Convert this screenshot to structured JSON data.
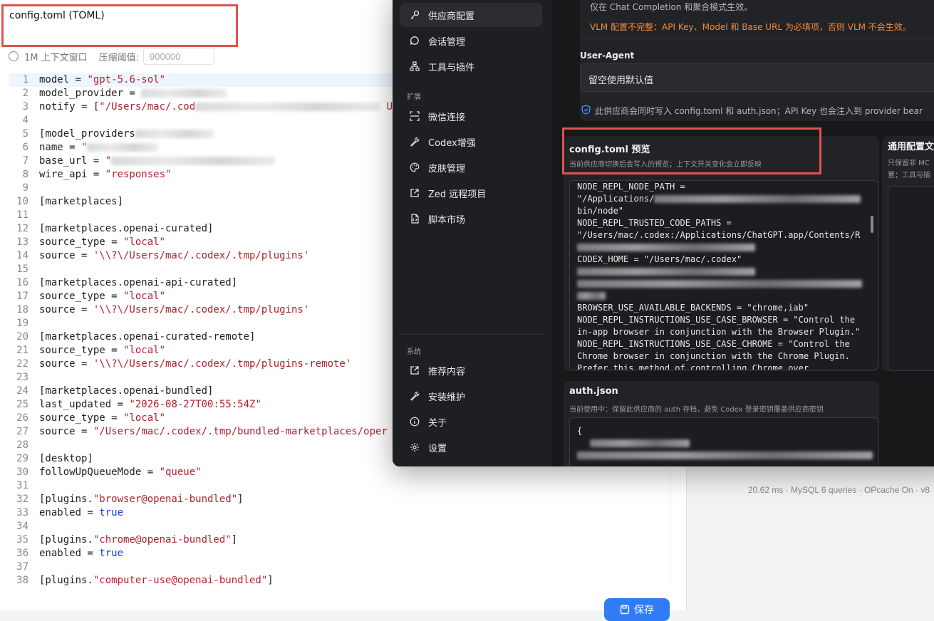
{
  "editor": {
    "title": "config.toml (TOML)",
    "context_label": "1M 上下文窗口",
    "threshold_label": "压缩阈值:",
    "threshold_placeholder": "900000",
    "save_label": "保存",
    "lines": [
      {
        "n": "1",
        "t": [
          [
            "model = ",
            ""
          ],
          [
            "\"gpt-5.6-sol\"",
            "s"
          ]
        ]
      },
      {
        "n": "2",
        "t": [
          [
            "model_provider = ",
            ""
          ]
        ],
        "blur": 120
      },
      {
        "n": "3",
        "t": [
          [
            "notify = [",
            ""
          ],
          [
            "\"/Users/mac/.cod",
            "s"
          ]
        ],
        "blur": 260,
        "tail": [
          [
            "U",
            "s"
          ]
        ]
      },
      {
        "n": "4",
        "t": []
      },
      {
        "n": "5",
        "t": [
          [
            "[model_providers",
            ""
          ]
        ],
        "blur": 110
      },
      {
        "n": "6",
        "t": [
          [
            "name = ",
            ""
          ],
          [
            "\"",
            "s"
          ]
        ],
        "blur": 100
      },
      {
        "n": "7",
        "t": [
          [
            "base_url = ",
            ""
          ],
          [
            "\"",
            "s"
          ]
        ],
        "blur": 230
      },
      {
        "n": "8",
        "t": [
          [
            "wire_api = ",
            ""
          ],
          [
            "\"responses\"",
            "s"
          ]
        ]
      },
      {
        "n": "9",
        "t": []
      },
      {
        "n": "10",
        "t": [
          [
            "[marketplaces]",
            ""
          ]
        ]
      },
      {
        "n": "11",
        "t": []
      },
      {
        "n": "12",
        "t": [
          [
            "[marketplaces.openai-curated]",
            ""
          ]
        ]
      },
      {
        "n": "13",
        "t": [
          [
            "source_type = ",
            ""
          ],
          [
            "\"local\"",
            "s"
          ]
        ]
      },
      {
        "n": "14",
        "t": [
          [
            "source = ",
            ""
          ],
          [
            "'\\\\?\\/Users/mac/.codex/.tmp/plugins'",
            "s"
          ]
        ]
      },
      {
        "n": "15",
        "t": []
      },
      {
        "n": "16",
        "t": [
          [
            "[marketplaces.openai-api-curated]",
            ""
          ]
        ]
      },
      {
        "n": "17",
        "t": [
          [
            "source_type = ",
            ""
          ],
          [
            "\"local\"",
            "s"
          ]
        ]
      },
      {
        "n": "18",
        "t": [
          [
            "source = ",
            ""
          ],
          [
            "'\\\\?\\/Users/mac/.codex/.tmp/plugins'",
            "s"
          ]
        ]
      },
      {
        "n": "19",
        "t": []
      },
      {
        "n": "20",
        "t": [
          [
            "[marketplaces.openai-curated-remote]",
            ""
          ]
        ]
      },
      {
        "n": "21",
        "t": [
          [
            "source_type = ",
            ""
          ],
          [
            "\"local\"",
            "s"
          ]
        ]
      },
      {
        "n": "22",
        "t": [
          [
            "source = ",
            ""
          ],
          [
            "'\\\\?\\/Users/mac/.codex/.tmp/plugins-remote'",
            "s"
          ]
        ]
      },
      {
        "n": "23",
        "t": []
      },
      {
        "n": "24",
        "t": [
          [
            "[marketplaces.openai-bundled]",
            ""
          ]
        ]
      },
      {
        "n": "25",
        "t": [
          [
            "last_updated = ",
            ""
          ],
          [
            "\"2026-08-27T00:55:54Z\"",
            "s"
          ]
        ]
      },
      {
        "n": "26",
        "t": [
          [
            "source_type = ",
            ""
          ],
          [
            "\"local\"",
            "s"
          ]
        ]
      },
      {
        "n": "27",
        "t": [
          [
            "source = ",
            ""
          ],
          [
            "\"/Users/mac/.codex/.tmp/bundled-marketplaces/oper",
            "s"
          ]
        ]
      },
      {
        "n": "28",
        "t": []
      },
      {
        "n": "29",
        "t": [
          [
            "[desktop]",
            ""
          ]
        ]
      },
      {
        "n": "30",
        "t": [
          [
            "followUpQueueMode = ",
            ""
          ],
          [
            "\"queue\"",
            "s"
          ]
        ]
      },
      {
        "n": "31",
        "t": []
      },
      {
        "n": "32",
        "t": [
          [
            "[plugins.",
            ""
          ],
          [
            "\"browser@openai-bundled\"",
            "s"
          ],
          [
            "]",
            ""
          ]
        ]
      },
      {
        "n": "33",
        "t": [
          [
            "enabled = ",
            ""
          ],
          [
            "true",
            "k"
          ]
        ]
      },
      {
        "n": "34",
        "t": []
      },
      {
        "n": "35",
        "t": [
          [
            "[plugins.",
            ""
          ],
          [
            "\"chrome@openai-bundled\"",
            "s"
          ],
          [
            "]",
            ""
          ]
        ]
      },
      {
        "n": "36",
        "t": [
          [
            "enabled = ",
            ""
          ],
          [
            "true",
            "k"
          ]
        ]
      },
      {
        "n": "37",
        "t": []
      },
      {
        "n": "38",
        "t": [
          [
            "[plugins.",
            ""
          ],
          [
            "\"computer-use@openai-bundled\"",
            "s"
          ],
          [
            "]",
            ""
          ]
        ]
      }
    ]
  },
  "footer_stats": "20.62 ms · MySQL 6 queries · OPcache On · v8",
  "app": {
    "sidebar": {
      "items_top": [
        {
          "label": "供应商配置",
          "icon": "key-icon",
          "active": true
        },
        {
          "label": "会话管理",
          "icon": "chat-icon"
        },
        {
          "label": "工具与插件",
          "icon": "nodes-icon"
        }
      ],
      "section_ext": "扩展",
      "items_ext": [
        {
          "label": "微信连接",
          "icon": "scan-icon"
        },
        {
          "label": "Codex增强",
          "icon": "wrench-icon"
        },
        {
          "label": "皮肤管理",
          "icon": "palette-icon"
        },
        {
          "label": "Zed 远程项目",
          "icon": "external-link-icon"
        },
        {
          "label": "脚本市场",
          "icon": "file-code-icon"
        }
      ],
      "section_sys": "系统",
      "items_sys": [
        {
          "label": "推荐内容",
          "icon": "external-link-icon"
        },
        {
          "label": "安装维护",
          "icon": "wrench-icon"
        },
        {
          "label": "关于",
          "icon": "info-icon"
        },
        {
          "label": "设置",
          "icon": "gear-icon"
        }
      ]
    },
    "main": {
      "chat_note": "仅在 Chat Completion 和聚合模式生效。",
      "vlm_warning": "VLM 配置不完整：API Key、Model 和 Base URL 为必填项，否则 VLM 不会生效。",
      "ua_label": "User-Agent",
      "ua_value": "留空使用默认值",
      "write_note": "此供应商会同时写入 config.toml 和 auth.json；API Key 也会注入到 provider bear",
      "preview_title": "config.toml 预览",
      "preview_desc": "当前供应商切换后会写入的预览；上下文开关变化会立即反映",
      "preview_lines": [
        "NODE_REPL_NODE_PATH =",
        "\"/Applications/",
        "bin/node\"",
        "NODE_REPL_TRUSTED_CODE_PATHS =",
        "\"/Users/mac/.codex:/Applications/ChatGPT.app/Contents/R",
        "",
        "CODEX_HOME = \"/Users/mac/.codex\"",
        "",
        "",
        "",
        "BROWSER_USE_AVAILABLE_BACKENDS = \"chrome,iab\"",
        "NODE_REPL_INSTRUCTIONS_USE_CASE_BROWSER = \"Control the",
        "in-app browser in conjunction with the Browser Plugin.\"",
        "NODE_REPL_INSTRUCTIONS_USE_CASE_CHROME = \"Control the",
        "Chrome browser in conjunction with the Chrome Plugin.",
        "Prefer this method of controlling Chrome over"
      ],
      "general_title": "通用配置文",
      "general_desc1": "只保留非 MC",
      "general_desc2": "置；工具与插",
      "auth_title": "auth.json",
      "auth_desc": "当前使用中：保留此供应商的 auth 存档，避免 Codex 登录密钥覆盖供应商密钥",
      "auth_first_line": "{"
    }
  }
}
